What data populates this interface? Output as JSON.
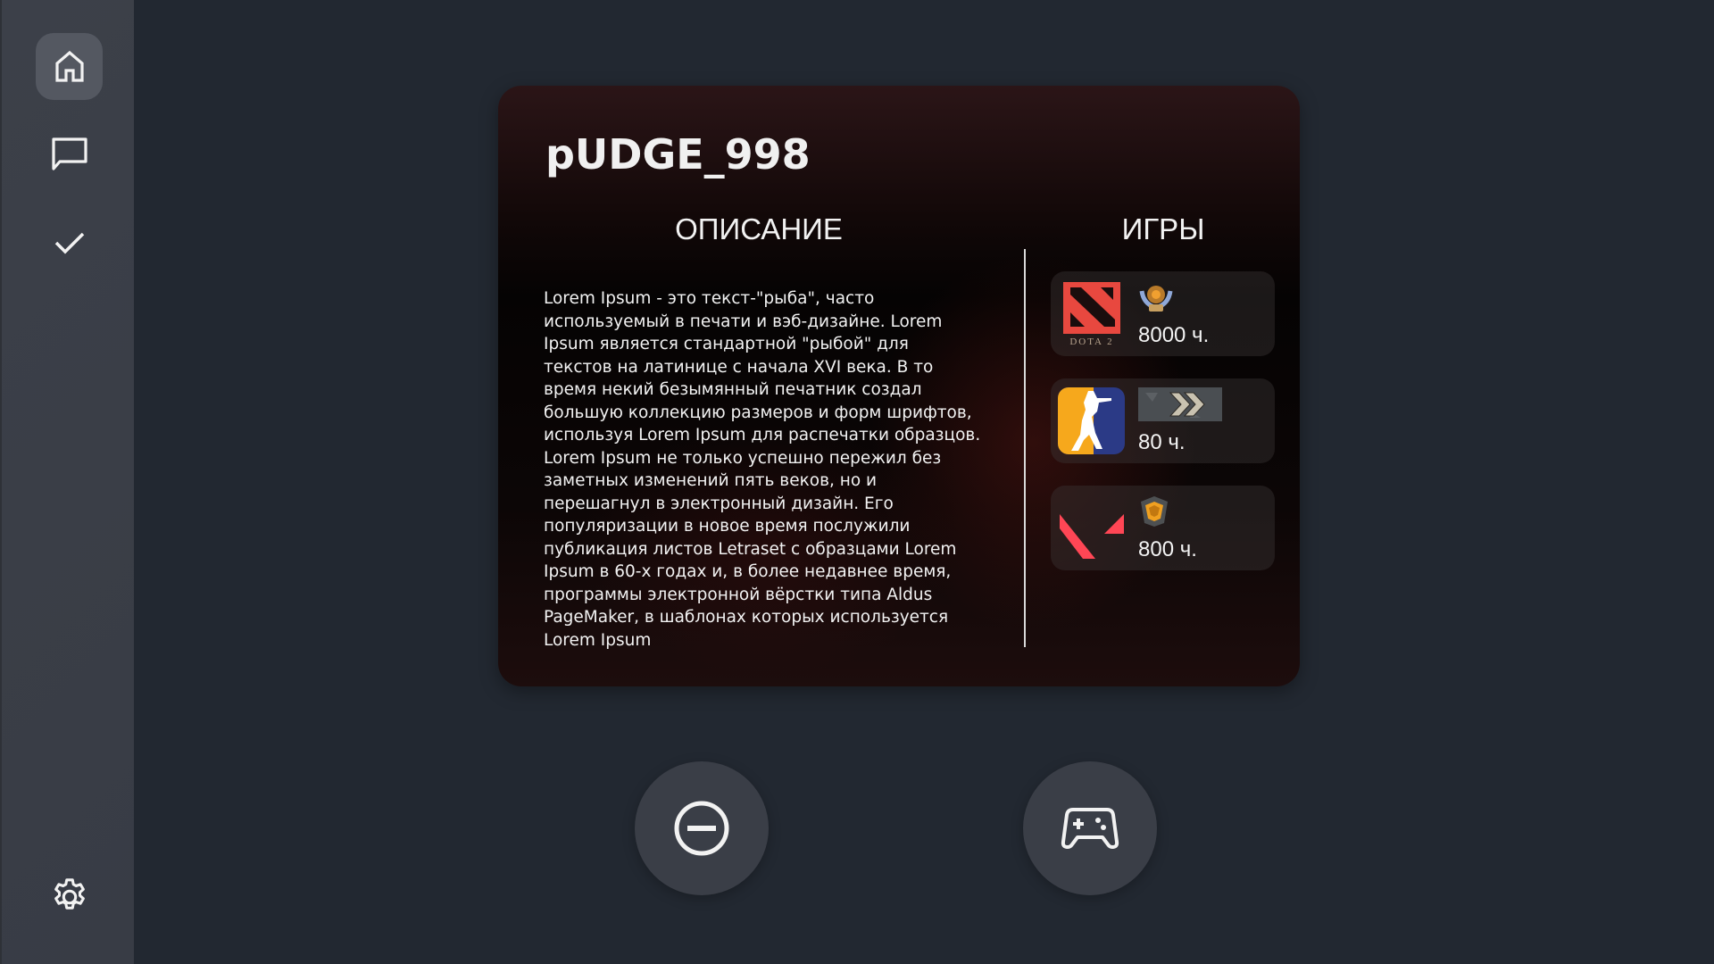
{
  "sidebar": {
    "items": [
      {
        "icon": "home-icon",
        "active": true
      },
      {
        "icon": "chat-icon",
        "active": false
      },
      {
        "icon": "check-icon",
        "active": false
      }
    ],
    "settings_icon": "gear-icon"
  },
  "profile": {
    "username": "pUDGE_998",
    "description_heading": "ОПИСАНИЕ",
    "description": "Lorem Ipsum - это текст-\"рыба\", часто используемый в печати и вэб-дизайне. Lorem Ipsum является стандартной \"рыбой\" для текстов на латинице с начала XVI века. В то время некий безымянный печатник создал большую коллекцию размеров и форм шрифтов, используя Lorem Ipsum для распечатки образцов. Lorem Ipsum не только успешно пережил без заметных изменений пять веков, но и перешагнул в электронный дизайн. Его популяризации в новое время послужили публикация листов Letraset с образцами Lorem Ipsum в 60-х годах и, в более недавнее время, программы электронной вёрстки типа Aldus PageMaker, в шаблонах которых используется Lorem Ipsum",
    "games_heading": "ИГРЫ",
    "games": [
      {
        "name": "Dota 2",
        "logo_text": "DOTA 2",
        "rank_icon": "dota-rank-medal-icon",
        "hours": "8000 ч.",
        "color": "#e8483f"
      },
      {
        "name": "Counter-Strike",
        "rank_icon": "cs-rank-silver-chevron-icon",
        "hours": "80 ч.",
        "color": "#f6a81c"
      },
      {
        "name": "Valorant",
        "rank_icon": "valorant-rank-gold-icon",
        "hours": "800 ч.",
        "color": "#ff4655"
      }
    ]
  },
  "actions": {
    "remove_icon": "minus-circle-icon",
    "play_icon": "gamepad-icon"
  },
  "colors": {
    "background": "#222831",
    "sidebar": "#3a3e47",
    "active_nav": "#545861",
    "button": "#3a3e47"
  }
}
